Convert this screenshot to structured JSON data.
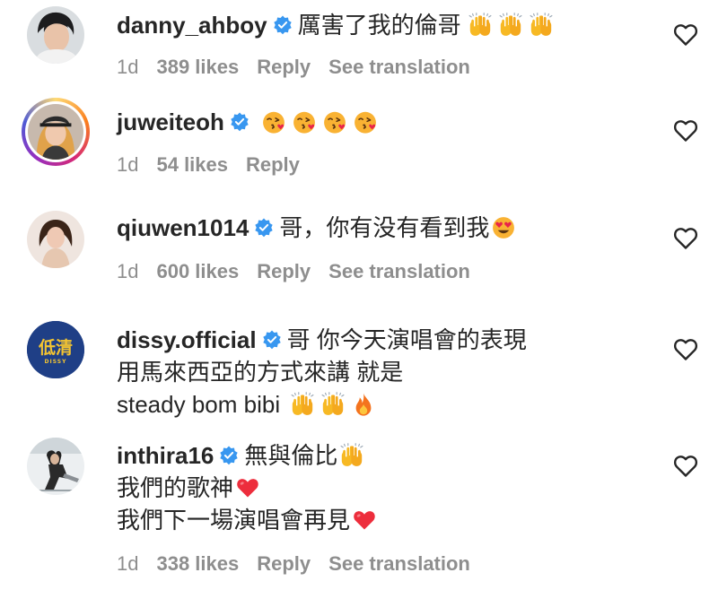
{
  "colors": {
    "text": "#262626",
    "muted": "#8e8e8e",
    "verified": "#3897f0",
    "heart_red": "#ed2d3c"
  },
  "comments": [
    {
      "username": "danny_ahboy",
      "verified": true,
      "lines": [
        "厲害了我的倫哥"
      ],
      "emojis": [
        "raising-hands",
        "raising-hands",
        "raising-hands"
      ],
      "time": "1d",
      "likes": "389 likes",
      "reply": "Reply",
      "translate": "See translation"
    },
    {
      "username": "juweiteoh",
      "verified": true,
      "lines": [
        ""
      ],
      "emojis": [
        "face-blowing-kiss",
        "face-blowing-kiss",
        "face-blowing-kiss",
        "face-blowing-kiss"
      ],
      "time": "1d",
      "likes": "54 likes",
      "reply": "Reply"
    },
    {
      "username": "qiuwen1014",
      "verified": true,
      "lines": [
        "哥，你有没有看到我"
      ],
      "emojis": [
        "heart-eyes"
      ],
      "time": "1d",
      "likes": "600 likes",
      "reply": "Reply",
      "translate": "See translation"
    },
    {
      "username": "dissy.official",
      "verified": true,
      "lines": [
        "哥 你今天演唱會的表現",
        "用馬來西亞的方式來講 就是",
        "steady bom bibi"
      ],
      "emojis": [
        "raising-hands",
        "raising-hands",
        "fire"
      ],
      "avatar_text": "低清",
      "avatar_subtext": "DISSY"
    },
    {
      "username": "inthira16",
      "verified": true,
      "lines": [
        "無與倫比",
        "我們的歌神",
        "我們下一場演唱會再見"
      ],
      "emojis": [
        "raising-hands",
        "red-heart",
        "red-heart"
      ],
      "time": "1d",
      "likes": "338 likes",
      "reply": "Reply",
      "translate": "See translation"
    }
  ]
}
